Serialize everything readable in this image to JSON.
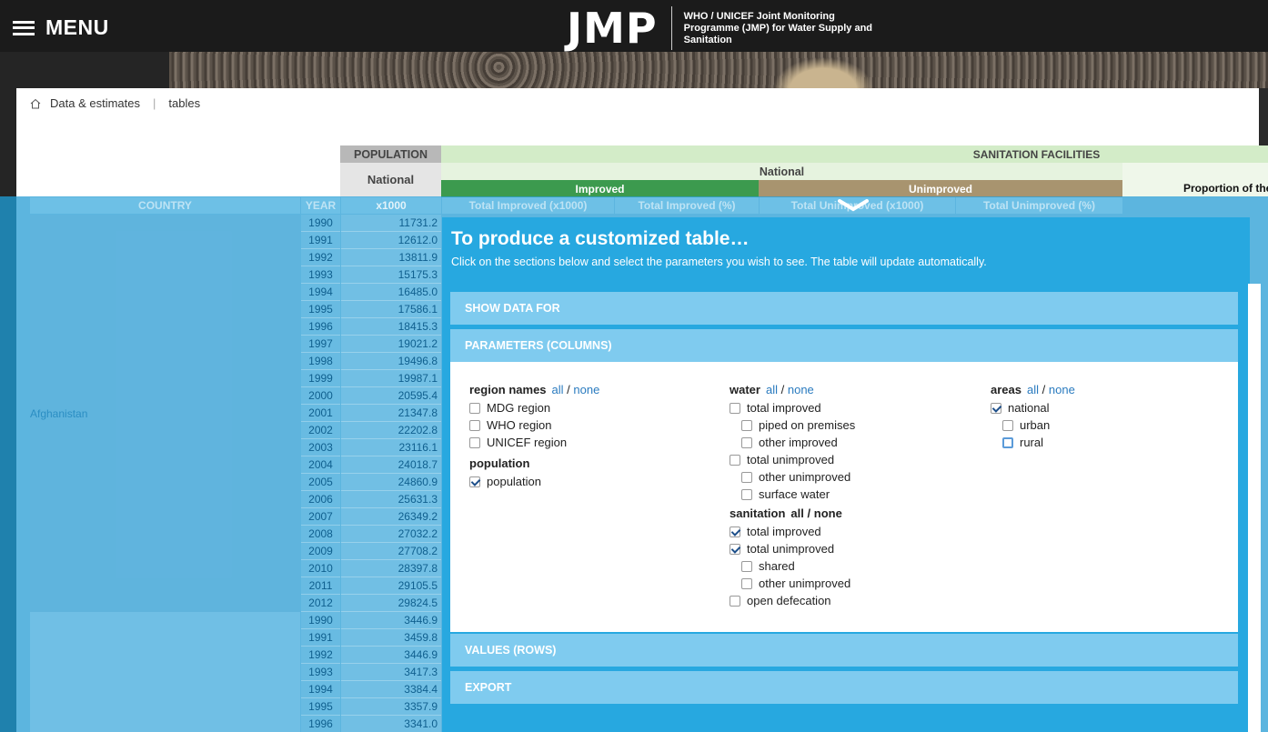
{
  "header": {
    "menu_label": "MENU",
    "logo_text": "JMP",
    "logo_subtitle": "WHO / UNICEF Joint Monitoring Programme (JMP) for Water Supply and Sanitation"
  },
  "breadcrumb": {
    "item1": "Data & estimates",
    "item2": "tables"
  },
  "table": {
    "population_header": "POPULATION",
    "national_header": "National",
    "sanitation_header": "SANITATION FACILITIES",
    "national_header2": "National",
    "improved_header": "Improved",
    "unimproved_header": "Unimproved",
    "proportion_header": "Proportion of the",
    "columns": {
      "country": "COUNTRY",
      "year": "YEAR",
      "x1000": "x1000",
      "total_improved_x1000": "Total Improved (x1000)",
      "total_improved_pct": "Total Improved (%)",
      "total_unimproved_x1000": "Total Unimproved (x1000)",
      "total_unimproved_pct": "Total Unimproved (%)"
    },
    "country1": "Afghanistan",
    "years": [
      "1990",
      "1991",
      "1992",
      "1993",
      "1994",
      "1995",
      "1996",
      "1997",
      "1998",
      "1999",
      "2000",
      "2001",
      "2002",
      "2003",
      "2004",
      "2005",
      "2006",
      "2007",
      "2008",
      "2009",
      "2010",
      "2011",
      "2012",
      "1990",
      "1991",
      "1992",
      "1993",
      "1994",
      "1995",
      "1996"
    ],
    "values": [
      "11731.2",
      "12612.0",
      "13811.9",
      "15175.3",
      "16485.0",
      "17586.1",
      "18415.3",
      "19021.2",
      "19496.8",
      "19987.1",
      "20595.4",
      "21347.8",
      "22202.8",
      "23116.1",
      "24018.7",
      "24860.9",
      "25631.3",
      "26349.2",
      "27032.2",
      "27708.2",
      "28397.8",
      "29105.5",
      "29824.5",
      "3446.9",
      "3459.8",
      "3446.9",
      "3417.3",
      "3384.4",
      "3357.9",
      "3341.0"
    ]
  },
  "panel": {
    "title": "To produce a customized table…",
    "description": "Click on the sections below and select the parameters you wish to see. The table will update automatically.",
    "sections": {
      "show_data_for": "SHOW DATA FOR",
      "parameters": "PARAMETERS (COLUMNS)",
      "values": "VALUES (ROWS)",
      "export": "EXPORT"
    },
    "all": "all",
    "none": "none",
    "region_names": {
      "label": "region names",
      "options": [
        {
          "label": "MDG region",
          "checked": false
        },
        {
          "label": "WHO region",
          "checked": false
        },
        {
          "label": "UNICEF region",
          "checked": false
        }
      ]
    },
    "population": {
      "label": "population",
      "options": [
        {
          "label": "population",
          "checked": true
        }
      ]
    },
    "water": {
      "label": "water",
      "options": [
        {
          "label": "total improved",
          "checked": false,
          "indent": false
        },
        {
          "label": "piped on premises",
          "checked": false,
          "indent": true
        },
        {
          "label": "other improved",
          "checked": false,
          "indent": true
        },
        {
          "label": "total unimproved",
          "checked": false,
          "indent": false
        },
        {
          "label": "other unimproved",
          "checked": false,
          "indent": true
        },
        {
          "label": "surface water",
          "checked": false,
          "indent": true
        }
      ]
    },
    "sanitation": {
      "label": "sanitation",
      "options": [
        {
          "label": "total improved",
          "checked": true,
          "indent": false
        },
        {
          "label": "total unimproved",
          "checked": true,
          "indent": false
        },
        {
          "label": "shared",
          "checked": false,
          "indent": true
        },
        {
          "label": "other unimproved",
          "checked": false,
          "indent": true
        },
        {
          "label": "open defecation",
          "checked": false,
          "indent": false
        }
      ]
    },
    "areas": {
      "label": "areas",
      "options": [
        {
          "label": "national",
          "checked": true,
          "indent": false
        },
        {
          "label": "urban",
          "checked": false,
          "indent": true
        },
        {
          "label": "rural",
          "checked": false,
          "indent": true,
          "focus": true
        }
      ]
    }
  }
}
